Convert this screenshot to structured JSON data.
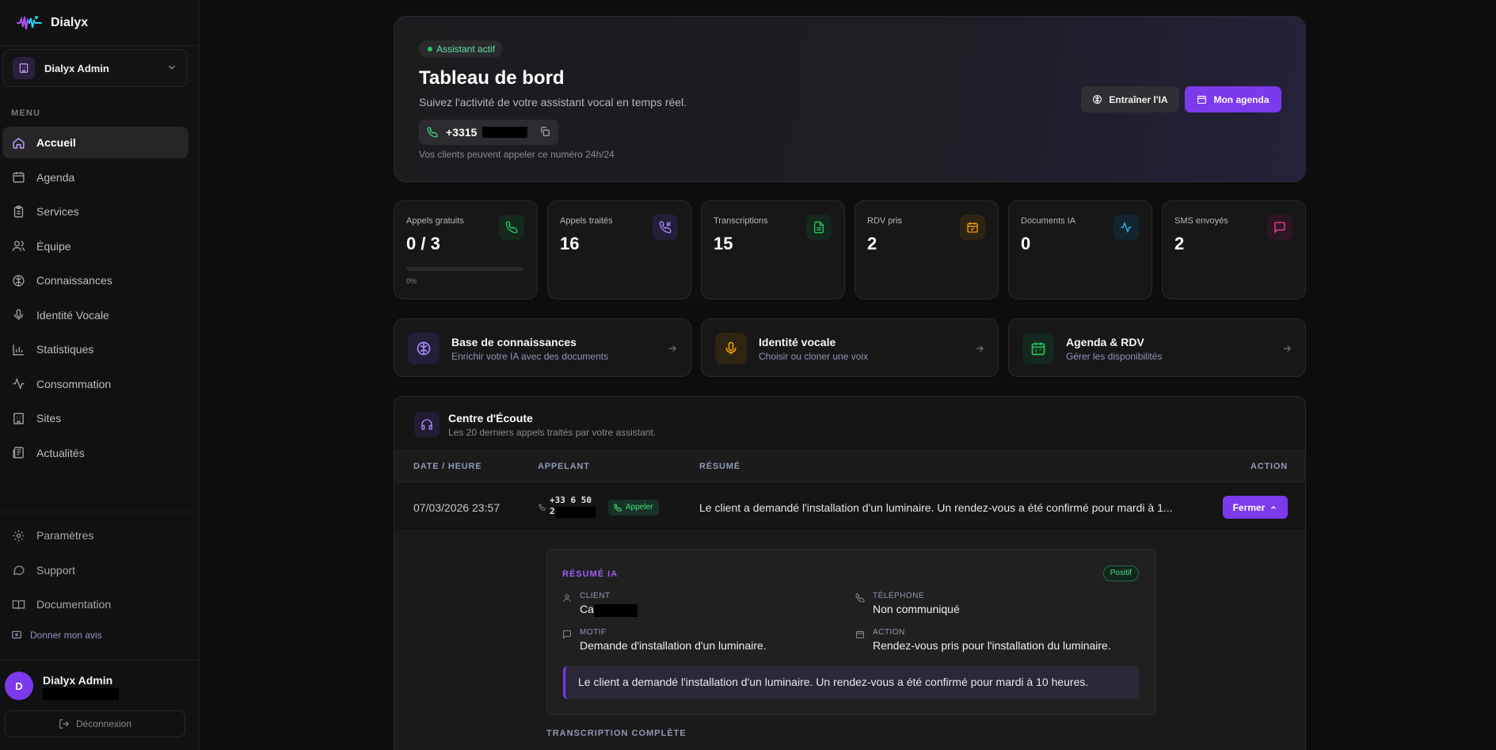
{
  "brand": {
    "name": "Dialyx"
  },
  "workspace": {
    "name": "Dialyx Admin"
  },
  "sidebar": {
    "menu_title": "MENU",
    "items": [
      {
        "label": "Accueil",
        "icon": "home-icon",
        "active": true
      },
      {
        "label": "Agenda",
        "icon": "calendar-icon"
      },
      {
        "label": "Services",
        "icon": "clipboard-icon"
      },
      {
        "label": "Équipe",
        "icon": "users-icon"
      },
      {
        "label": "Connaissances",
        "icon": "brain-icon"
      },
      {
        "label": "Identité Vocale",
        "icon": "mic-icon"
      },
      {
        "label": "Statistiques",
        "icon": "bar-chart-icon"
      },
      {
        "label": "Consommation",
        "icon": "activity-icon"
      },
      {
        "label": "Sites",
        "icon": "building-icon"
      },
      {
        "label": "Actualités",
        "icon": "newspaper-icon"
      }
    ],
    "bottom_items": [
      {
        "label": "Paramètres",
        "icon": "gear-icon"
      },
      {
        "label": "Support",
        "icon": "message-circle-icon"
      },
      {
        "label": "Documentation",
        "icon": "book-icon"
      }
    ],
    "feedback": "Donner mon avis",
    "user": {
      "initial": "D",
      "name": "Dialyx Admin"
    },
    "logout": "Déconnexion"
  },
  "hero": {
    "badge": "Assistant actif",
    "title": "Tableau de bord",
    "subtitle": "Suivez l'activité de votre assistant vocal en temps réel.",
    "phone": "+3315",
    "note": "Vos clients peuvent appeler ce numéro 24h/24",
    "train_button": "Entraîner l'IA",
    "agenda_button": "Mon agenda"
  },
  "stats": [
    {
      "label": "Appels gratuits",
      "value": "0 / 3",
      "icon": "phone-icon",
      "color": "#22c55e",
      "progress": 0,
      "progress_label": "0%"
    },
    {
      "label": "Appels traités",
      "value": "16",
      "icon": "phone-incoming-icon",
      "color": "#a78bfa"
    },
    {
      "label": "Transcriptions",
      "value": "15",
      "icon": "file-text-icon",
      "color": "#22c55e"
    },
    {
      "label": "RDV pris",
      "value": "2",
      "icon": "calendar-check-icon",
      "color": "#f59e0b"
    },
    {
      "label": "Documents IA",
      "value": "0",
      "icon": "activity-icon",
      "color": "#38bdf8"
    },
    {
      "label": "SMS envoyés",
      "value": "2",
      "icon": "message-square-icon",
      "color": "#ec4899"
    }
  ],
  "quick_links": [
    {
      "title": "Base de connaissances",
      "subtitle": "Enrichir votre IA avec des documents",
      "icon": "brain-icon",
      "color": "#a78bfa"
    },
    {
      "title": "Identité vocale",
      "subtitle": "Choisir ou cloner une voix",
      "icon": "mic-icon",
      "color": "#f59e0b"
    },
    {
      "title": "Agenda & RDV",
      "subtitle": "Gérer les disponibilités",
      "icon": "calendar-icon",
      "color": "#22c55e"
    }
  ],
  "listening": {
    "title": "Centre d'Écoute",
    "subtitle": "Les 20 derniers appels traités par votre assistant.",
    "columns": [
      "DATE / HEURE",
      "APPELANT",
      "RÉSUMÉ",
      "ACTION"
    ],
    "row": {
      "date": "07/03/2026 23:57",
      "phone_line1": "+33 6 50",
      "phone_line2": "2",
      "call_label": "Appeler",
      "summary": "Le client a demandé l'installation d'un luminaire. Un rendez-vous a été confirmé pour mardi à 1...",
      "action": "Fermer"
    },
    "detail": {
      "title": "RÉSUMÉ IA",
      "sentiment": "Positif",
      "client_label": "CLIENT",
      "client_value": "Ca",
      "phone_label": "TÉLÉPHONE",
      "phone_value": "Non communiqué",
      "reason_label": "MOTIF",
      "reason_value": "Demande d'installation d'un luminaire.",
      "action_label": "ACTION",
      "action_value": "Rendez-vous pris pour l'installation du luminaire.",
      "quote": "Le client a demandé l'installation d'un luminaire. Un rendez-vous a été confirmé pour mardi à 10 heures."
    },
    "transcript_title": "TRANSCRIPTION COMPLÈTE"
  }
}
